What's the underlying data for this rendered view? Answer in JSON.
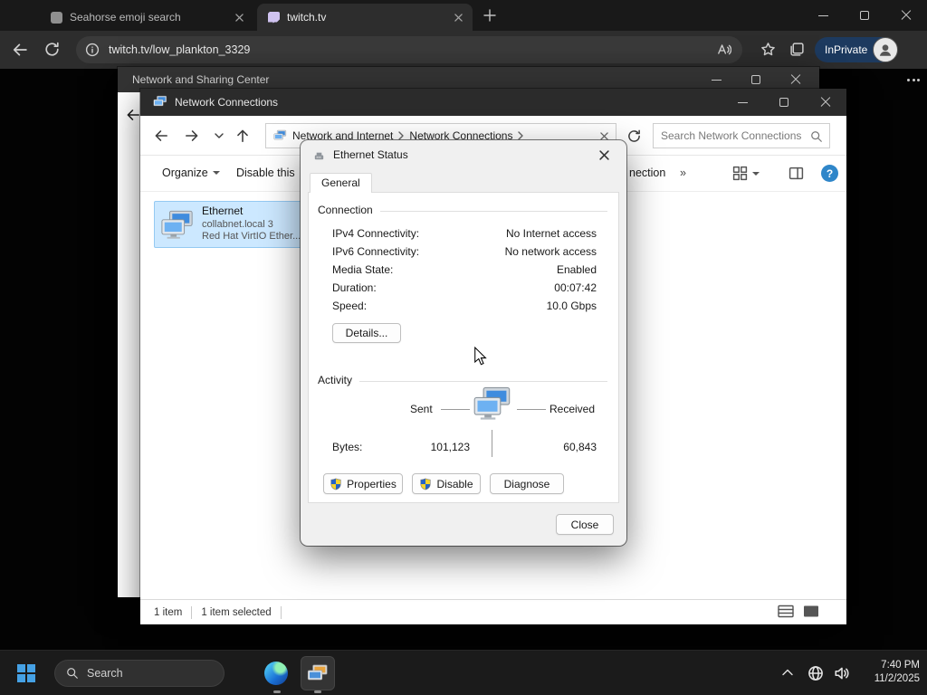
{
  "browser": {
    "tabs": [
      {
        "title": "Seahorse emoji search"
      },
      {
        "title": "twitch.tv"
      }
    ],
    "url": "twitch.tv/low_plankton_3329",
    "inprivate_label": "InPrivate"
  },
  "sharing_center_window": {
    "title": "Network and Sharing Center"
  },
  "connections_window": {
    "title": "Network Connections",
    "breadcrumb": {
      "segment1": "Network and Internet",
      "segment2": "Network Connections"
    },
    "search_placeholder": "Search Network Connections",
    "command_bar": {
      "organize_label": "Organize",
      "disable_label_fragment": "Disable this",
      "connection_label_fragment": "nection",
      "overflow_chevron": "»"
    },
    "item": {
      "name": "Ethernet",
      "network": "collabnet.local 3",
      "device": "Red Hat VirtIO Ether..."
    },
    "status_bar": {
      "items_count": "1 item",
      "selected_count": "1 item selected"
    }
  },
  "ethernet_status_dialog": {
    "title": "Ethernet Status",
    "tab_general": "General",
    "connection_group": {
      "header": "Connection",
      "rows": [
        {
          "label": "IPv4 Connectivity:",
          "value": "No Internet access"
        },
        {
          "label": "IPv6 Connectivity:",
          "value": "No network access"
        },
        {
          "label": "Media State:",
          "value": "Enabled"
        },
        {
          "label": "Duration:",
          "value": "00:07:42"
        },
        {
          "label": "Speed:",
          "value": "10.0 Gbps"
        }
      ],
      "details_button": "Details..."
    },
    "activity_group": {
      "header": "Activity",
      "sent_label": "Sent",
      "received_label": "Received",
      "bytes_label": "Bytes:",
      "bytes_sent": "101,123",
      "bytes_received": "60,843"
    },
    "buttons": {
      "properties": "Properties",
      "disable": "Disable",
      "diagnose": "Diagnose",
      "close": "Close"
    }
  },
  "taskbar": {
    "search_placeholder": "Search",
    "clock": {
      "time": "7:40 PM",
      "date": "11/2/2025"
    }
  },
  "icons": {
    "help_glyph": "?"
  },
  "colors": {
    "accent": "#0078d4",
    "selection_fill": "#cce8ff",
    "inprivate_badge": "#1d3a5f",
    "shield_blue": "#2463c9",
    "shield_yellow": "#f6d32b",
    "help_circle": "#2f86c9"
  }
}
